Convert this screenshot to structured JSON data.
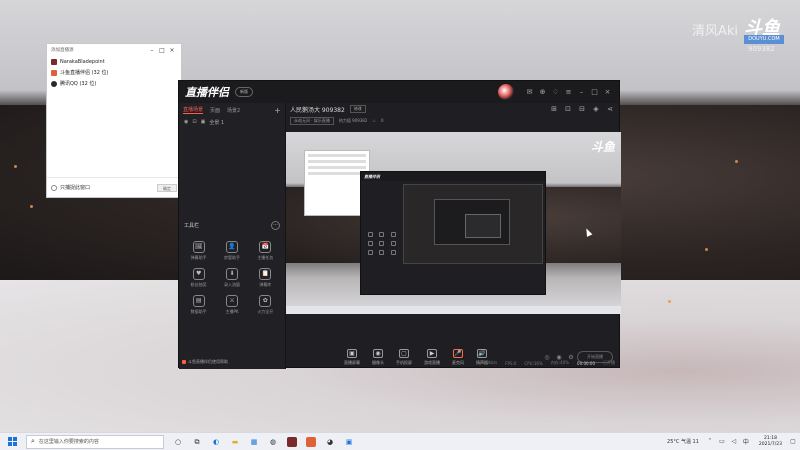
{
  "watermark": {
    "name": "清风Aki",
    "logo": "斗鱼",
    "badge": "DOUYU.COM",
    "room_id": "909382"
  },
  "source_window": {
    "title": "添加直播源",
    "items": [
      {
        "label": "NarakaBladepoint",
        "color": "#7a2a2a"
      },
      {
        "label": "斗鱼直播伴侣 (32 位)",
        "color": "#e0603a"
      },
      {
        "label": "腾讯QQ (32 位)",
        "color": "#2a2a2a"
      }
    ],
    "footer_label": "只捕捉此窗口",
    "footer_button": "确定"
  },
  "app": {
    "logo": "直播伴侣",
    "version": "新版",
    "left_tabs": [
      "直播场景",
      "页面",
      "场景2"
    ],
    "scene_label": "全景 1",
    "tools_title": "工具栏",
    "tools": [
      {
        "icon": "🖼",
        "label": "弹幕助手"
      },
      {
        "icon": "👤",
        "label": "房管助手"
      },
      {
        "icon": "📅",
        "label": "主播任务"
      },
      {
        "icon": "♥",
        "label": "粉丝抽奖"
      },
      {
        "icon": "⬇",
        "label": "录入流量"
      },
      {
        "icon": "📋",
        "label": "弹幕库"
      },
      {
        "icon": "▤",
        "label": "数据助手"
      },
      {
        "icon": "⚔",
        "label": "主播PK"
      },
      {
        "icon": "✿",
        "label": "火力全开"
      }
    ],
    "left_footer": "斗鱼直播伴侣使用帮助",
    "room_title": "人民鹅汤大 909382",
    "room_edit": "修改",
    "room_category": "永劫无间 · 娱乐直播",
    "room_fans": "热力值 909382",
    "room_hot": "0",
    "controls": [
      {
        "icon": "▣",
        "label": "直播屏幕"
      },
      {
        "icon": "◉",
        "label": "摄像头"
      },
      {
        "icon": "▢",
        "label": "手机投屏"
      },
      {
        "icon": "▶",
        "label": "游戏直播"
      },
      {
        "icon": "🎤",
        "label": "麦克风"
      },
      {
        "icon": "🔊",
        "label": "扬声器"
      }
    ],
    "go_live": "开始直播",
    "status": {
      "bitrate": "码率:0kb/s",
      "fps": "FPS:0",
      "cpu": "CPU:16%",
      "mem": "内存:40%",
      "timer": "00:00:00",
      "end": "已开播"
    }
  },
  "taskbar": {
    "search_placeholder": "在这里输入你要搜索的内容",
    "weather": "25°C 气温 11",
    "time": "21:18",
    "date": "2021/7/23"
  }
}
